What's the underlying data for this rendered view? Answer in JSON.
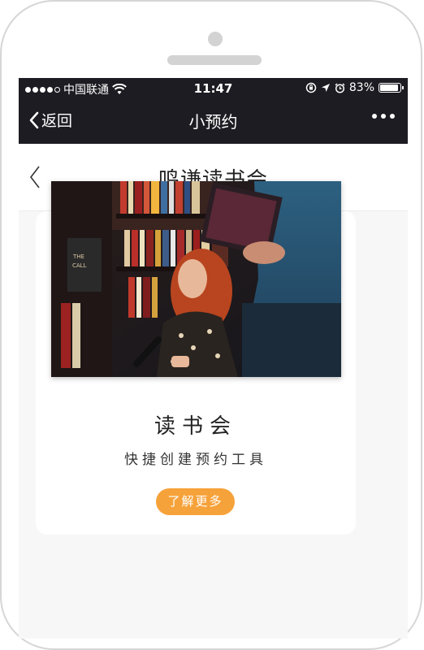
{
  "status_bar": {
    "carrier": "中国联通",
    "time": "11:47",
    "battery_percent": "83%",
    "battery_level": 0.83,
    "signal_strength": 4,
    "icons": [
      "signal-dots-icon",
      "wifi-icon",
      "orientation-lock-icon",
      "location-arrow-icon",
      "alarm-icon",
      "battery-icon"
    ]
  },
  "nav": {
    "back_label": "返回",
    "title": "小预约",
    "more_icon": "more-dots-icon"
  },
  "page": {
    "title": "鸣谦读书会",
    "back_icon": "chevron-left-icon"
  },
  "card": {
    "image_description_icon": "photo-image",
    "title": "读书会",
    "subtitle": "快捷创建预约工具",
    "button_label": "了解更多"
  },
  "colors": {
    "bar_background": "#1d1c22",
    "accent": "#f6a23a",
    "page_background": "#f7f7f7"
  }
}
